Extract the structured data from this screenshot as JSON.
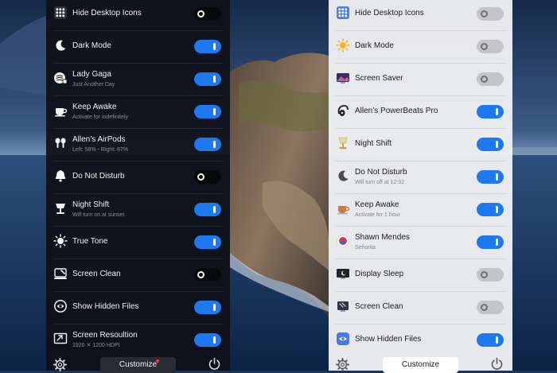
{
  "colors": {
    "toggle_on": "#1e78f0",
    "dark_panel_bg": "#0e1018",
    "light_panel_bg": "#eeeef1",
    "notification_dot": "#ff3b30"
  },
  "dark_panel": {
    "items": [
      {
        "title": "Hide Desktop Icons",
        "subtitle": "",
        "icon": "desktop-grid-icon",
        "on": false
      },
      {
        "title": "Dark Mode",
        "subtitle": "",
        "icon": "moon-icon",
        "on": true
      },
      {
        "title": "Lady Gaga",
        "subtitle": "Just Another Day",
        "icon": "music-player-icon",
        "on": true
      },
      {
        "title": "Keep Awake",
        "subtitle": "Activate for indefinitely",
        "icon": "coffee-cup-icon",
        "on": true
      },
      {
        "title": "Allen’s AirPods",
        "subtitle": "Left: 58% - Right: 67%",
        "icon": "airpods-icon",
        "on": true
      },
      {
        "title": "Do Not Disturb",
        "subtitle": "",
        "icon": "bell-icon",
        "on": false
      },
      {
        "title": "Night Shift",
        "subtitle": "Will turn on at sunset",
        "icon": "night-shift-lamp-icon",
        "on": true
      },
      {
        "title": "True Tone",
        "subtitle": "",
        "icon": "sun-icon",
        "on": true
      },
      {
        "title": "Screen Clean",
        "subtitle": "",
        "icon": "screen-clean-icon",
        "on": false
      },
      {
        "title": "Show Hidden Files",
        "subtitle": "",
        "icon": "eye-file-icon",
        "on": true
      },
      {
        "title": "Screen Resoultion",
        "subtitle": "1920 ✕ 1200 HDPI",
        "icon": "display-resize-icon",
        "on": true
      }
    ],
    "footer": {
      "customize_label": "Customize",
      "has_notification": true
    }
  },
  "light_panel": {
    "items": [
      {
        "title": "Hide Desktop Icons",
        "subtitle": "",
        "icon": "desktop-grid-icon",
        "on": false
      },
      {
        "title": "Dark Mode",
        "subtitle": "",
        "icon": "sun-icon",
        "on": false
      },
      {
        "title": "Screen Saver",
        "subtitle": "",
        "icon": "screen-saver-icon",
        "on": false
      },
      {
        "title": "Allen’s PowerBeats Pro",
        "subtitle": "",
        "icon": "powerbeats-icon",
        "on": true
      },
      {
        "title": "Night Shift",
        "subtitle": "",
        "icon": "night-shift-lamp-icon",
        "on": true
      },
      {
        "title": "Do Not Disturb",
        "subtitle": "Will turn off at 12:32",
        "icon": "moon-icon",
        "on": true
      },
      {
        "title": "Keep Awake",
        "subtitle": "Activate for 1 hour",
        "icon": "coffee-cup-icon",
        "on": true
      },
      {
        "title": "Shawn Mendes",
        "subtitle": "Señorita",
        "icon": "music-player-icon",
        "on": true
      },
      {
        "title": "Display Sleep",
        "subtitle": "",
        "icon": "display-sleep-icon",
        "on": false
      },
      {
        "title": "Screen Clean",
        "subtitle": "",
        "icon": "screen-clean-icon",
        "on": false
      },
      {
        "title": "Show Hidden Files",
        "subtitle": "",
        "icon": "eye-file-icon",
        "on": true
      }
    ],
    "footer": {
      "customize_label": "Customize",
      "has_notification": false
    }
  }
}
